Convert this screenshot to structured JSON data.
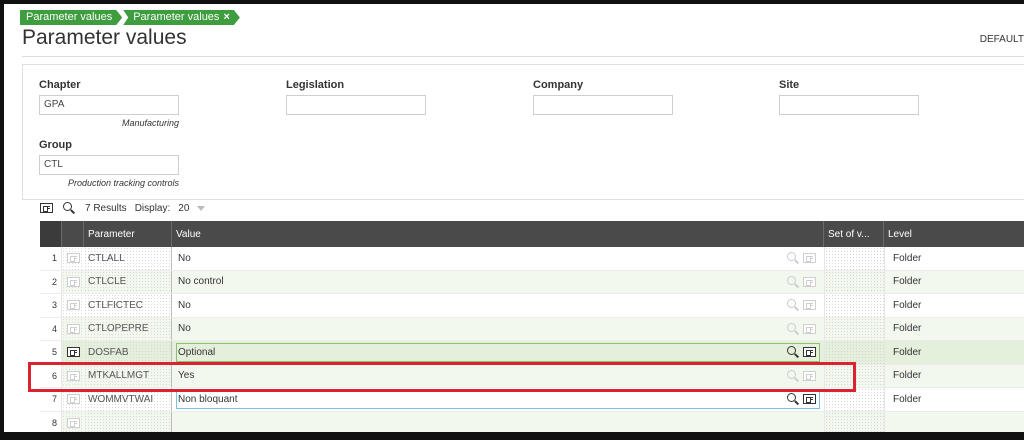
{
  "breadcrumb": [
    "Parameter values",
    "Parameter values"
  ],
  "breadcrumb_close": "×",
  "title": "Parameter values",
  "top_right": "DEFAULT",
  "fields": {
    "chapter": {
      "label": "Chapter",
      "value": "GPA",
      "desc": "Manufacturing"
    },
    "legislation": {
      "label": "Legislation",
      "value": ""
    },
    "company": {
      "label": "Company",
      "value": ""
    },
    "site": {
      "label": "Site",
      "value": ""
    },
    "group": {
      "label": "Group",
      "value": "CTL",
      "desc": "Production tracking controls"
    }
  },
  "toolbar": {
    "results": "7 Results",
    "display_label": "Display:",
    "display_value": "20"
  },
  "columns": {
    "parameter": "Parameter",
    "value": "Value",
    "set": "Set of v...",
    "level": "Level"
  },
  "rows": [
    {
      "num": "1",
      "param": "CTLALL",
      "value": "No",
      "level": "Folder"
    },
    {
      "num": "2",
      "param": "CTLCLE",
      "value": "No control",
      "level": "Folder"
    },
    {
      "num": "3",
      "param": "CTLFICTEC",
      "value": "No",
      "level": "Folder"
    },
    {
      "num": "4",
      "param": "CTLOPEPRE",
      "value": "No",
      "level": "Folder"
    },
    {
      "num": "5",
      "param": "DOSFAB",
      "value": "Optional",
      "level": "Folder"
    },
    {
      "num": "6",
      "param": "MTKALLMGT",
      "value": "Yes",
      "level": "Folder"
    },
    {
      "num": "7",
      "param": "WOMMVTWAI",
      "value": "Non bloquant",
      "level": "Folder"
    },
    {
      "num": "8",
      "param": "",
      "value": "",
      "level": ""
    }
  ],
  "colors": {
    "breadcrumb": "#3e9d3e",
    "header": "#4a4a4a",
    "highlight": "#d9232e"
  }
}
